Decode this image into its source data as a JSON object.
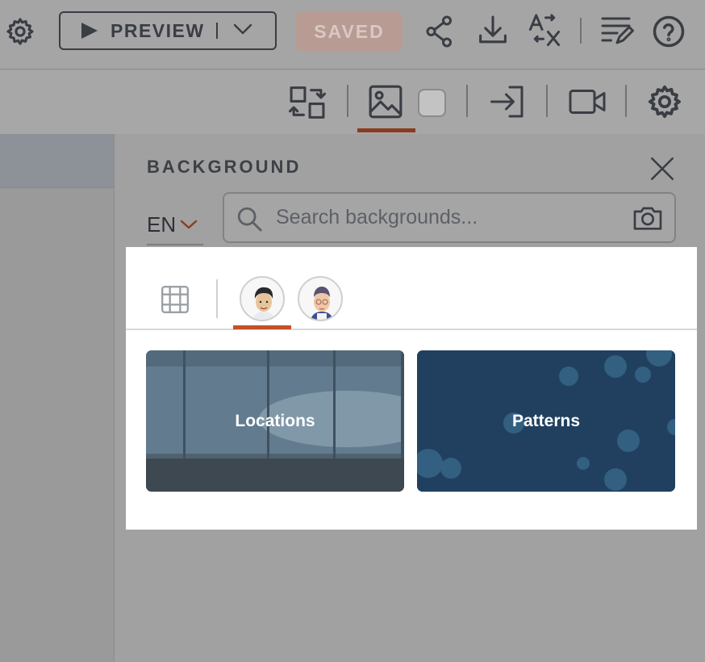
{
  "toolbar": {
    "preview_label": "PREVIEW",
    "saved_label": "SAVED",
    "icons": [
      "gear-icon",
      "play-icon",
      "chevron-down-icon",
      "share-icon",
      "download-icon",
      "translate-icon",
      "notes-edit-icon",
      "help-icon"
    ]
  },
  "subtoolbar": {
    "icons": [
      "swap-icon",
      "image-icon",
      "enter-icon",
      "camera-video-icon",
      "settings-icon"
    ],
    "active_tab": "image-icon"
  },
  "panel": {
    "title": "BACKGROUND",
    "language": "EN",
    "search_placeholder": "Search backgrounds...",
    "tabs": [
      "grid-view-icon",
      "avatar-style-1",
      "avatar-style-2"
    ],
    "active_tab": "avatar-style-1",
    "categories": [
      {
        "label": "Locations"
      },
      {
        "label": "Patterns"
      }
    ]
  },
  "colors": {
    "accent": "#c4502a",
    "saved_button": "#b89b93",
    "patterns_card": "#21405f",
    "locations_card": "#5b7386"
  }
}
